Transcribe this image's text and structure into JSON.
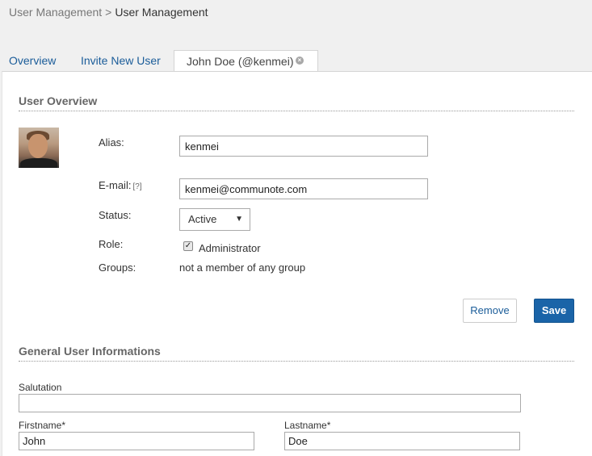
{
  "breadcrumb": {
    "parent": "User Management",
    "separator": ">",
    "current": "User Management"
  },
  "tabs": [
    {
      "label": "Overview"
    },
    {
      "label": "Invite New User"
    },
    {
      "label": "John Doe (@kenmei)",
      "active": true,
      "close_icon": "close-circle-icon"
    }
  ],
  "user_overview": {
    "title": "User Overview",
    "alias_label": "Alias:",
    "alias_value": "kenmei",
    "email_label": "E-mail:",
    "email_help": "[?]",
    "email_value": "kenmei@communote.com",
    "status_label": "Status:",
    "status_value": "Active",
    "role_label": "Role:",
    "role_option": "Administrator",
    "role_checked": true,
    "groups_label": "Groups:",
    "groups_value": "not a member of any group",
    "remove_label": "Remove",
    "save_label": "Save"
  },
  "general_info": {
    "title": "General User Informations",
    "salutation_label": "Salutation",
    "salutation_value": "",
    "firstname_label": "Firstname*",
    "firstname_value": "John",
    "lastname_label": "Lastname*",
    "lastname_value": "Doe"
  },
  "colors": {
    "link": "#1a5c99",
    "primary_button": "#1a64a8"
  }
}
